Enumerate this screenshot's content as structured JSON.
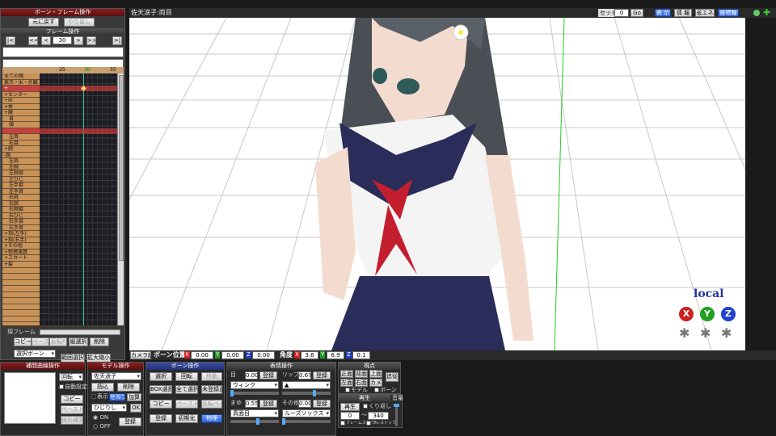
{
  "left_panel": {
    "title": "ボーン・フレーム操作",
    "undo": "元に戻す",
    "redo": "やり直し",
    "frame_section": "フレーム操作",
    "nav": [
      "|<",
      "<<",
      "<",
      ">",
      ">>",
      ">|"
    ],
    "frame_number": "30",
    "ruler": [
      "25",
      "30",
      "35"
    ],
    "bones": [
      "全ての親",
      "表示・IK・外観",
      "+",
      "+センター",
      "+IK",
      "+体",
      "+腰",
      "首",
      "頭",
      "",
      "左目",
      "右目",
      "+腕",
      "-腕",
      "左肩",
      "左腕",
      "左腕捩",
      "左ひじ",
      "左手捩",
      "左手首",
      "右肩",
      "右腕",
      "右腕捩",
      "右ひじ",
      "右手捩",
      "右手首",
      "+指(左手)",
      "+指(右手)",
      "+その他",
      "+物理演算",
      "+スカート",
      "+髪",
      "",
      "",
      "",
      "",
      "",
      "",
      "",
      "",
      "",
      ""
    ],
    "current_frame_label": "現フレーム",
    "copy": "コピー",
    "paste": "ペースト",
    "reverse_paste": "反転P",
    "vertical_select": "縦選択",
    "delete": "削除",
    "select_dropdown": "選択ボーン",
    "range_select": "範囲選択",
    "expand": "拡大縮小"
  },
  "interp_panel": {
    "title": "補間曲線操作",
    "rotate": "回転",
    "auto_setting": "自動設定",
    "copy": "コピー",
    "paste": "ペースト",
    "linear": "線形補間"
  },
  "model_panel": {
    "title": "モデル操作",
    "model_name": "佐天涙子",
    "load": "読込",
    "delete": "削除",
    "display": "表示",
    "selfshadow": "セルフ影",
    "add": "加算",
    "morph": "ひじりし",
    "ok": "OK",
    "on": "ON",
    "off": "OFF",
    "register": "登録"
  },
  "bone_panel": {
    "title": "ボーン操作",
    "select": "選択",
    "rotate": "回転",
    "move": "移動",
    "box_select": "BOX選択",
    "select_all": "全て選択",
    "unregistered": "未登録選",
    "copy": "コピー",
    "paste": "ペースト",
    "reverse": "反転ペースト",
    "register": "登録",
    "initialize": "初期化",
    "physics": "物理"
  },
  "facial_panel": {
    "title": "表情操作",
    "eye_label": "目",
    "eye_value": "0.000",
    "lip_label": "リップ",
    "lip_value": "0.670",
    "eye_morph": "ウィンク",
    "lip_morph": "▲",
    "brow_label": "まゆ",
    "brow_value": "0.550",
    "other_label": "その他",
    "other_value": "0.000",
    "brow_morph": "真面目",
    "other_morph": "ルーズソックス",
    "register": "登録"
  },
  "view_panel": {
    "title": "視点",
    "front": "正面",
    "back": "背面",
    "top": "上面",
    "left": "左面",
    "right": "右面",
    "camera": "カメラ",
    "follow": "追従",
    "model": "モデル",
    "bone": "ボーン"
  },
  "play_panel": {
    "title": "再生",
    "play": "再生",
    "loop": "くり返し",
    "from": "0",
    "to": "340",
    "frame_start": "フレームスタート",
    "frame_stop": "フレストップ",
    "volume": "音量"
  },
  "viewport": {
    "title": "佐天涙子:両目",
    "set_label": "セット",
    "set_value": "0",
    "go": "Go",
    "btn1": "表 示",
    "btn2": "情 報",
    "btn3": "省エネ",
    "btn4": "座標軸",
    "local": "local",
    "gizmo_x": "X",
    "gizmo_y": "Y",
    "gizmo_z": "Z"
  },
  "camera_bar": {
    "camera_edit": "カメラ編",
    "bone_position": "ボーン位置",
    "x_label": "X",
    "y_label": "Y",
    "z_label": "Z",
    "pos_x": "0.00",
    "pos_y": "0.00",
    "pos_z": "0.00",
    "angle": "角度",
    "ang_x": "3.6",
    "ang_y": "6.9",
    "ang_z": "0.1"
  },
  "colors": {
    "accent_red": "#8a1f1f",
    "accent_blue": "#2c5ed8",
    "gizmo_x": "#d02020",
    "gizmo_y": "#20a020",
    "gizmo_z": "#2040d0"
  }
}
